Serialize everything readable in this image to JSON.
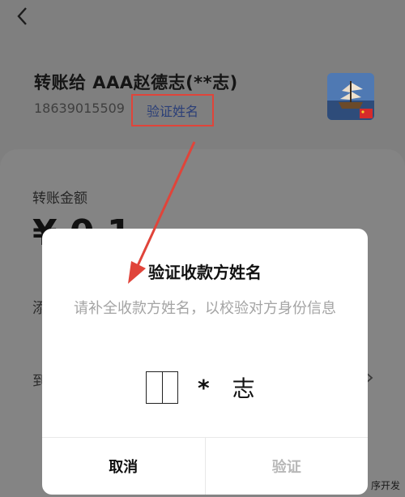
{
  "header": {
    "title": "转账给 AAA赵德志(**志)",
    "phone": "18639015509",
    "verify_name_link": "验证姓名"
  },
  "transfer": {
    "amount_label": "转账金额",
    "amount_peek": "¥ 0 1",
    "row_peek_1": "添",
    "row_peek_2": "到"
  },
  "dialog": {
    "title": "验证收款方姓名",
    "description": "请补全收款方姓名，以校验对方身份信息",
    "masked_chars": "*",
    "known_char": "志",
    "cancel_label": "取消",
    "verify_label": "验证"
  },
  "watermark": "序开发",
  "colors": {
    "annotation_red": "#e0443a",
    "link_blue": "#2b3f78",
    "disabled_gray": "#b8b8b8"
  },
  "icons": {
    "back": "chevron-left-icon",
    "row_arrow": "chevron-right-icon"
  }
}
